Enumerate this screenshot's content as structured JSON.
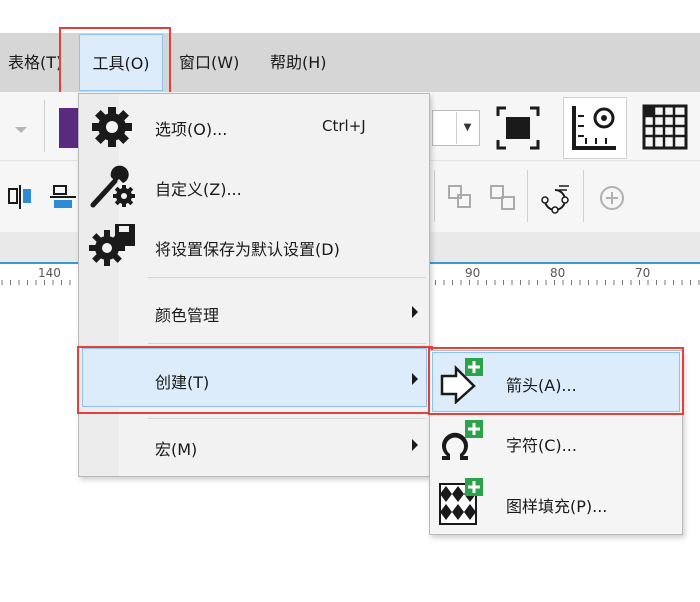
{
  "menubar": {
    "items": [
      {
        "label": "表格(T)"
      },
      {
        "label": "工具(O)"
      },
      {
        "label": "窗口(W)"
      },
      {
        "label": "帮助(H)"
      }
    ]
  },
  "ruler": {
    "ticks": [
      "140",
      "90",
      "80",
      "70"
    ]
  },
  "tools_menu": {
    "items": [
      {
        "label": "选项(O)...",
        "shortcut": "Ctrl+J",
        "icon": "gear-icon"
      },
      {
        "label": "自定义(Z)...",
        "icon": "wrench-gear-icon"
      },
      {
        "label": "将设置保存为默认设置(D)",
        "icon": "save-settings-icon"
      },
      {
        "label": "颜色管理",
        "submenu": true
      },
      {
        "label": "创建(T)",
        "submenu": true
      },
      {
        "label": "宏(M)",
        "submenu": true
      }
    ]
  },
  "create_submenu": {
    "items": [
      {
        "label": "箭头(A)...",
        "icon": "new-arrow-icon"
      },
      {
        "label": "字符(C)...",
        "icon": "new-character-icon"
      },
      {
        "label": "图样填充(P)...",
        "icon": "new-pattern-fill-icon"
      }
    ]
  },
  "colors": {
    "highlight": "#dcecfb",
    "highlight_border": "#8fc3ec",
    "callout": "#e2403c",
    "plus_badge": "#2aa34a"
  }
}
